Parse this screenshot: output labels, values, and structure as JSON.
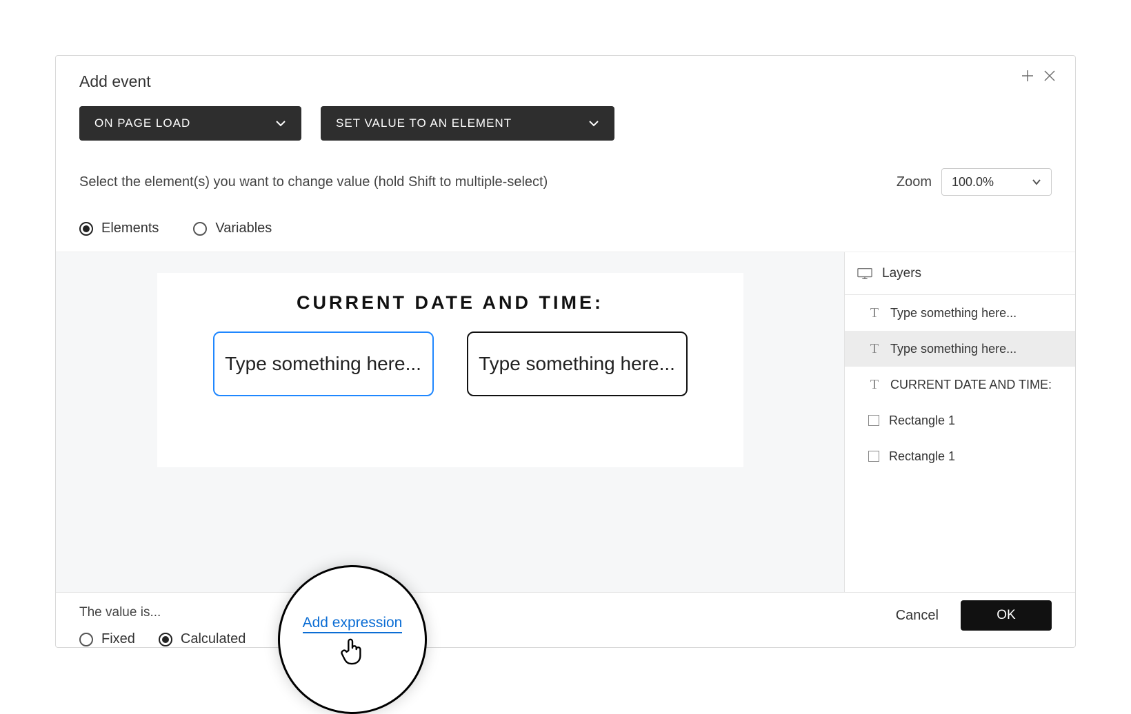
{
  "dialog": {
    "title": "Add event"
  },
  "selects": {
    "trigger": "ON PAGE LOAD",
    "action": "SET VALUE TO AN ELEMENT"
  },
  "instruction": "Select the element(s) you want to change value (hold Shift to multiple-select)",
  "zoom": {
    "label": "Zoom",
    "value": "100.0%"
  },
  "targetTabs": {
    "elements": "Elements",
    "variables": "Variables"
  },
  "artboard": {
    "title": "CURRENT DATE AND TIME:",
    "input1": "Type something here...",
    "input2": "Type something here..."
  },
  "layers": {
    "header": "Layers",
    "items": [
      {
        "label": "Type something here..."
      },
      {
        "label": "Type something here..."
      },
      {
        "label": "CURRENT DATE AND TIME:"
      },
      {
        "label": "Rectangle 1"
      },
      {
        "label": "Rectangle 1"
      }
    ]
  },
  "footer": {
    "valueLabel": "The value is...",
    "fixed": "Fixed",
    "calculated": "Calculated",
    "addExpression": "Add expression",
    "cancel": "Cancel",
    "ok": "OK"
  }
}
